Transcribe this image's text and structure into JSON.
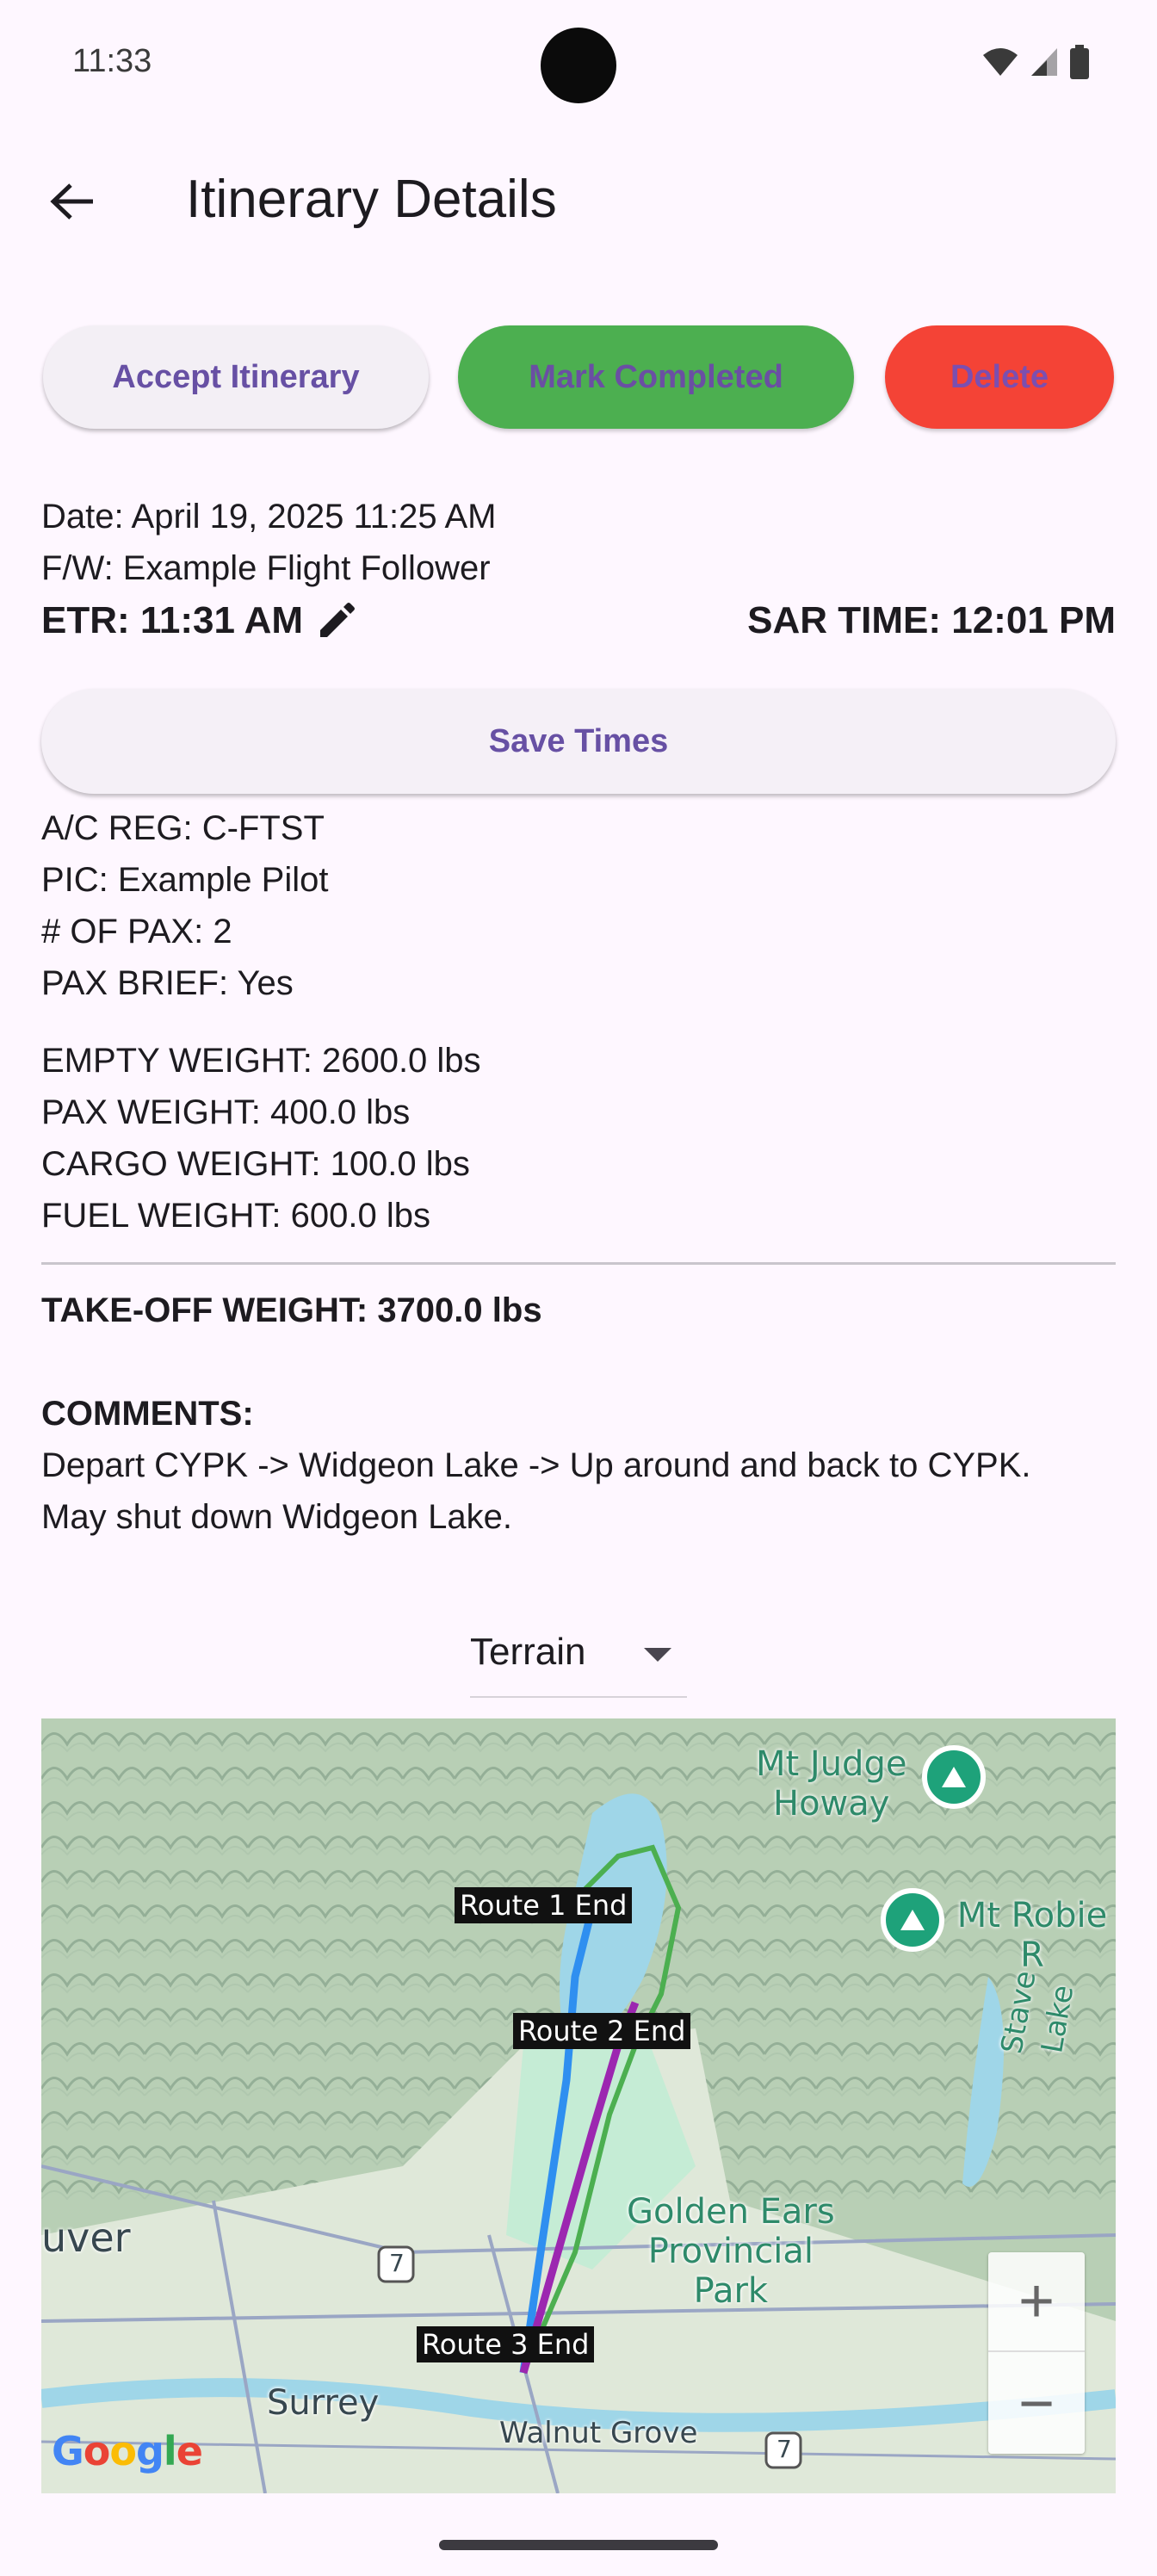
{
  "status_bar": {
    "time": "11:33"
  },
  "app_bar": {
    "title": "Itinerary Details"
  },
  "actions": {
    "accept_label": "Accept Itinerary",
    "complete_label": "Mark Completed",
    "delete_label": "Delete"
  },
  "details": {
    "date": "Date: April 19, 2025 11:25 AM",
    "flight_follower": "F/W: Example Flight Follower",
    "etr": "ETR: 11:31 AM",
    "sar_time": "SAR TIME: 12:01 PM",
    "save_times_label": "Save Times",
    "ac_reg": "A/C REG: C-FTST",
    "pic": "PIC: Example Pilot",
    "num_pax": "# OF PAX: 2",
    "pax_brief": "PAX BRIEF: Yes",
    "empty_weight": "EMPTY WEIGHT: 2600.0 lbs",
    "pax_weight": "PAX WEIGHT: 400.0 lbs",
    "cargo_weight": "CARGO WEIGHT: 100.0 lbs",
    "fuel_weight": "FUEL WEIGHT: 600.0 lbs",
    "takeoff_weight": "TAKE-OFF WEIGHT: 3700.0 lbs",
    "comments_heading": "COMMENTS:",
    "comments_line1": "Depart CYPK -> Widgeon Lake -> Up around and back to CYPK.",
    "comments_line2": "May shut down Widgeon Lake."
  },
  "map_type": {
    "selected": "Terrain"
  },
  "map": {
    "route_labels": [
      "Route 1 End",
      "Route 2 End",
      "Route 3 End"
    ],
    "places": {
      "mt_judge_1": "Mt Judge",
      "mt_judge_2": "Howay",
      "mt_robie": "Mt Robie R",
      "stave_lake": "Stave Lake",
      "golden_ears_1": "Golden Ears",
      "golden_ears_2": "Provincial",
      "golden_ears_3": "Park",
      "vancouver_fragment": "uver",
      "surrey": "Surrey",
      "walnut_grove": "Walnut Grove",
      "highway_7a": "7",
      "highway_7b": "7"
    },
    "zoom_in": "+",
    "zoom_out": "−",
    "attribution": "Google",
    "colors": {
      "route1": "#2f8ff0",
      "route2": "#9c27b0",
      "route3": "#4caf50"
    }
  }
}
